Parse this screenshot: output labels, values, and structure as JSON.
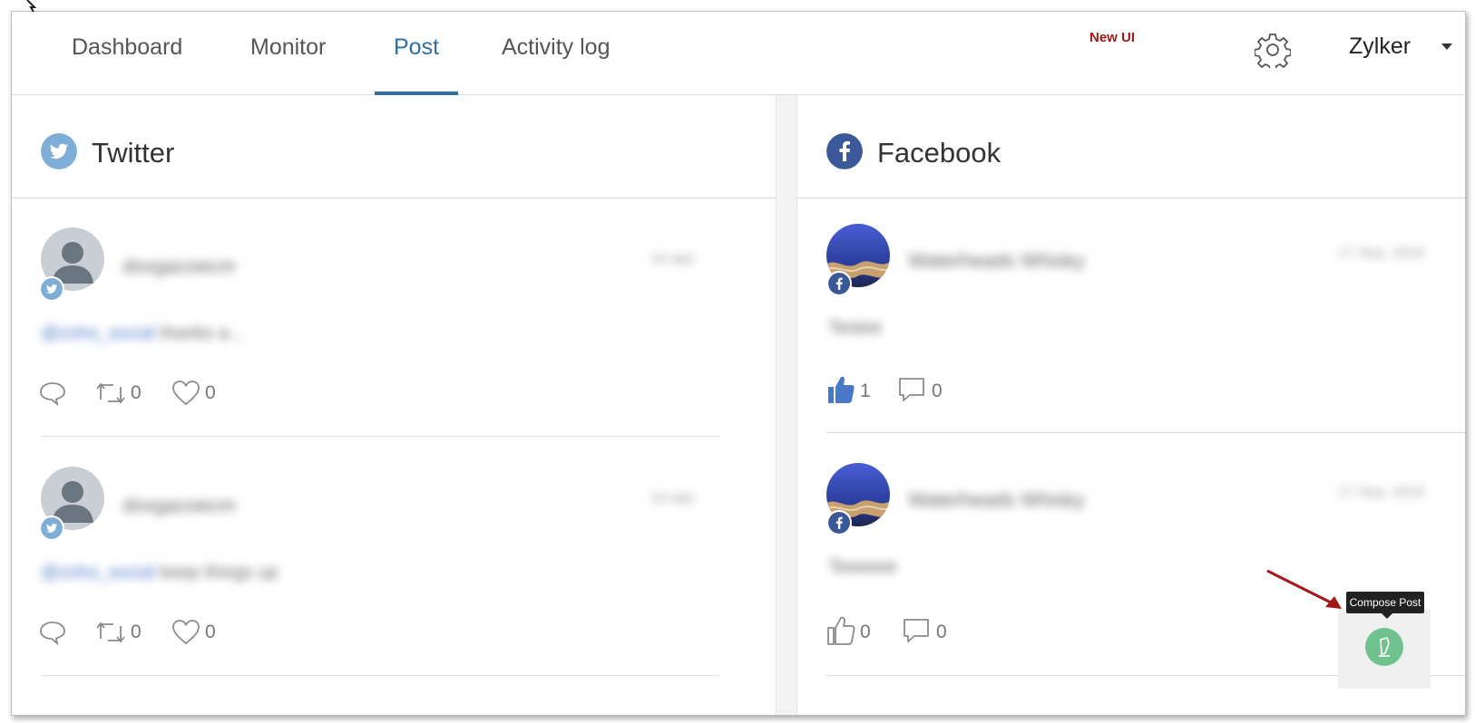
{
  "nav": {
    "tabs": [
      {
        "label": "Dashboard"
      },
      {
        "label": "Monitor"
      },
      {
        "label": "Post"
      },
      {
        "label": "Activity log"
      }
    ],
    "active_tab": "Post",
    "badge": "New UI",
    "user": "Zylker"
  },
  "twitter": {
    "title": "Twitter",
    "posts": [
      {
        "author": "doxgacoecm",
        "time": "1d ago",
        "mention": "@zoho_social",
        "text": "thanks a...",
        "replies": "",
        "retweets": "0",
        "likes": "0"
      },
      {
        "author": "doxgacoecm",
        "time": "1d ago",
        "mention": "@zoho_social",
        "text": "keep things up",
        "replies": "",
        "retweets": "0",
        "likes": "0"
      }
    ]
  },
  "facebook": {
    "title": "Facebook",
    "posts": [
      {
        "author": "Waterheads Whisky",
        "time": "17 Sep, 2019",
        "text": "Testee",
        "likes": "1",
        "comments": "0"
      },
      {
        "author": "Waterheads Whisky",
        "time": "17 Sep, 2019",
        "text": "Tewwwe",
        "likes": "0",
        "comments": "0"
      }
    ]
  },
  "compose": {
    "tooltip": "Compose Post"
  },
  "colors": {
    "accent": "#2f6ea5",
    "twitter": "#7eaed7",
    "facebook": "#3b5998",
    "compose": "#6fc28e",
    "badge": "#a01818"
  }
}
